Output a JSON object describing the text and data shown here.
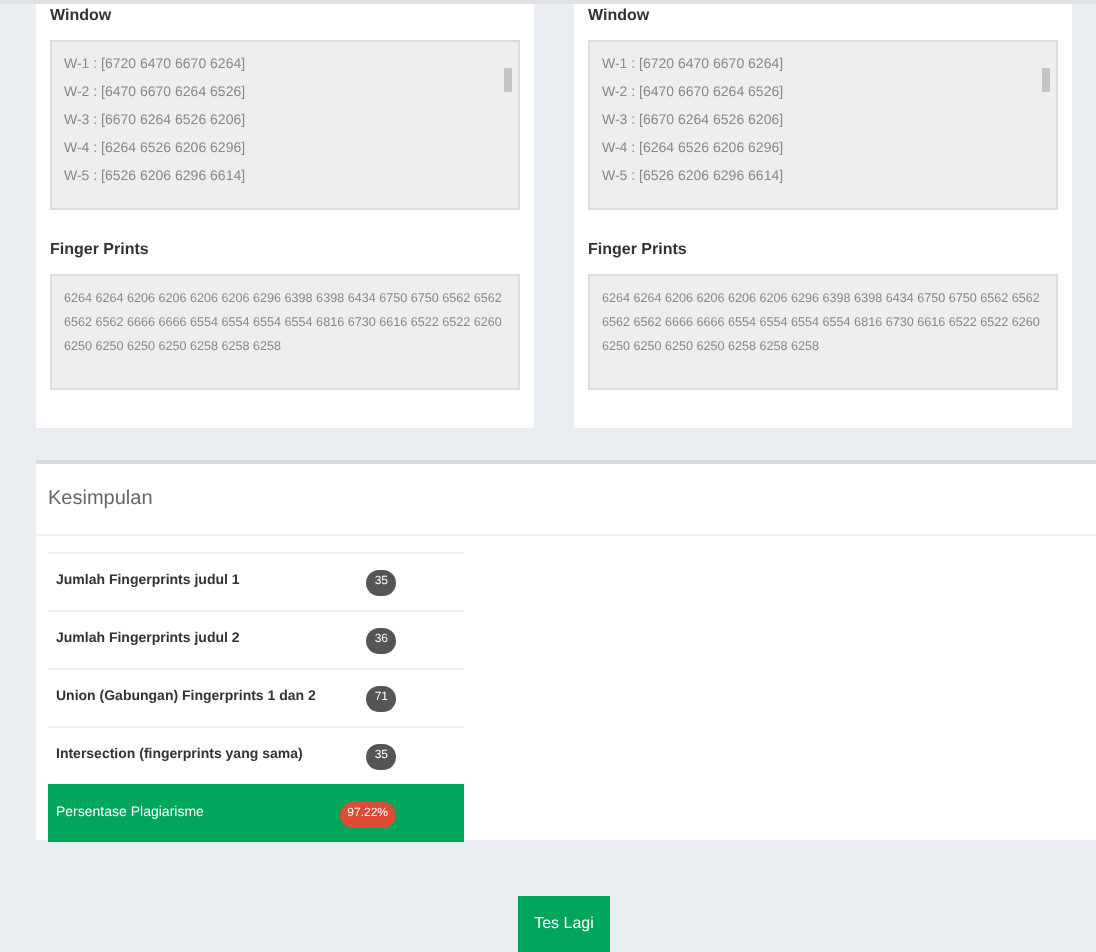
{
  "documents": [
    {
      "window_label": "Window",
      "windows": [
        "W-1 : [6720 6470 6670 6264]",
        "W-2 : [6470 6670 6264 6526]",
        "W-3 : [6670 6264 6526 6206]",
        "W-4 : [6264 6526 6206 6296]",
        "W-5 : [6526 6206 6296 6614]"
      ],
      "fingerprints_label": "Finger Prints",
      "fingerprints": "6264 6264 6206 6206 6206 6206 6296 6398 6398 6434 6750 6750 6562 6562 6562 6562 6666 6666 6554 6554 6554 6554 6816 6730 6616 6522 6522 6260 6250 6250 6250 6250 6258 6258 6258"
    },
    {
      "window_label": "Window",
      "windows": [
        "W-1 : [6720 6470 6670 6264]",
        "W-2 : [6470 6670 6264 6526]",
        "W-3 : [6670 6264 6526 6206]",
        "W-4 : [6264 6526 6206 6296]",
        "W-5 : [6526 6206 6296 6614]"
      ],
      "fingerprints_label": "Finger Prints",
      "fingerprints": "6264 6264 6206 6206 6206 6206 6296 6398 6398 6434 6750 6750 6562 6562 6562 6562 6666 6666 6554 6554 6554 6554 6816 6730 6616 6522 6522 6260 6250 6250 6250 6250 6258 6258 6258"
    }
  ],
  "summary": {
    "title": "Kesimpulan",
    "rows": [
      {
        "label": "Jumlah Fingerprints judul 1",
        "value": "35",
        "kind": "normal"
      },
      {
        "label": "Jumlah Fingerprints judul 2",
        "value": "36",
        "kind": "normal"
      },
      {
        "label": "Union (Gabungan) Fingerprints 1 dan 2",
        "value": "71",
        "kind": "normal"
      },
      {
        "label": "Intersection (fingerprints yang sama)",
        "value": "35",
        "kind": "normal"
      },
      {
        "label": "Persentase Plagiarisme",
        "value": "97.22%",
        "kind": "result"
      }
    ]
  },
  "button": "Tes Lagi"
}
